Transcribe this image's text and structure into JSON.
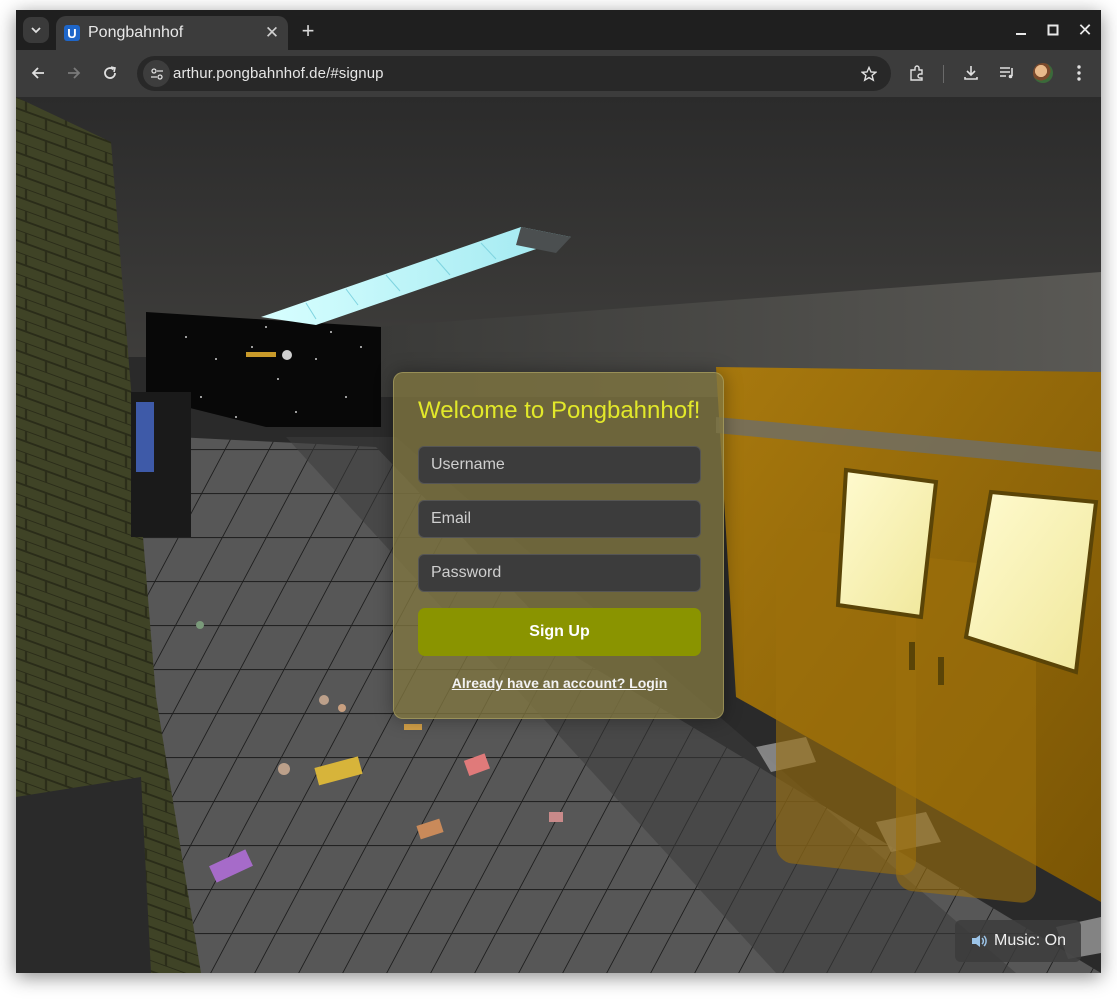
{
  "browser": {
    "tab_title": "Pongbahnhof",
    "tab_favicon_letter": "U",
    "url": "arthur.pongbahnhof.de/#signup",
    "icons": [
      "tab-search-icon",
      "close-icon",
      "plus-icon",
      "minimize-icon",
      "maximize-icon",
      "window-close-icon",
      "back-icon",
      "forward-icon",
      "reload-icon",
      "site-info-icon",
      "star-icon",
      "extensions-icon",
      "download-icon",
      "media-icon",
      "avatar",
      "kebab-menu-icon"
    ]
  },
  "signup": {
    "title": "Welcome to Pongbahnhof!",
    "username_placeholder": "Username",
    "email_placeholder": "Email",
    "password_placeholder": "Password",
    "submit_label": "Sign Up",
    "login_link": "Already have an account? Login"
  },
  "music": {
    "icon": "speaker-icon",
    "label": "Music: On"
  },
  "colors": {
    "title": "#e2e82a",
    "button": "#8a9400",
    "card": "#807640"
  }
}
